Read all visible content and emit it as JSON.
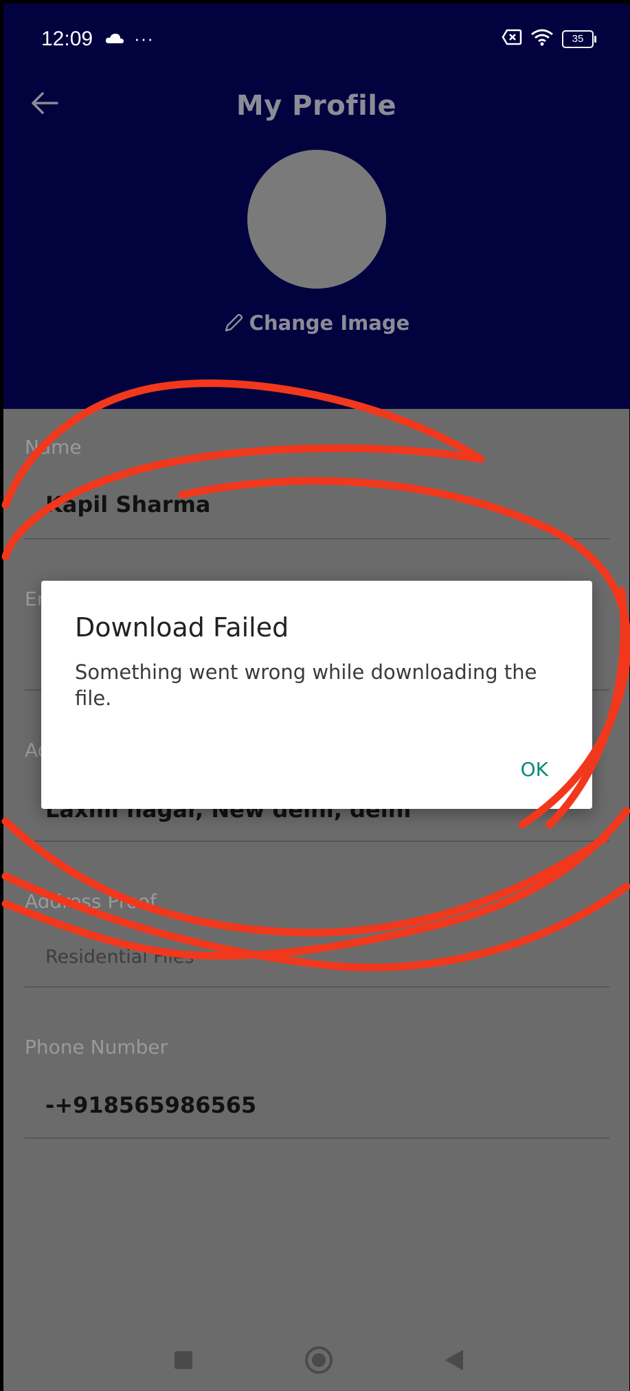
{
  "status_bar": {
    "time": "12:09",
    "left_icons": [
      "cloud-icon",
      "more-dots-icon"
    ],
    "dots": "···",
    "battery": "35",
    "right_icons": [
      "sim-blocked-icon",
      "wifi-icon",
      "battery-icon"
    ]
  },
  "header": {
    "title": "My Profile",
    "change_image_label": "Change Image",
    "background_color": "#02023f"
  },
  "form": {
    "fields": [
      {
        "label": "Name",
        "value": "Kapil Sharma"
      },
      {
        "label": "Email",
        "value": ""
      },
      {
        "label": "Address",
        "value": "Laxmi nagar, New delhi, delhi"
      },
      {
        "label": "Address Proof",
        "placeholder": "Residential Files"
      },
      {
        "label": "Phone Number",
        "value": "-+918565986565"
      }
    ]
  },
  "dialog": {
    "title": "Download Failed",
    "message": "Something went wrong while downloading the file.",
    "ok_label": "OK",
    "accent_color": "#00897b"
  },
  "annotation": {
    "color": "#f2381c"
  },
  "nav_bar": {
    "icons": [
      "recents-square-icon",
      "home-circle-icon",
      "back-triangle-icon"
    ]
  }
}
